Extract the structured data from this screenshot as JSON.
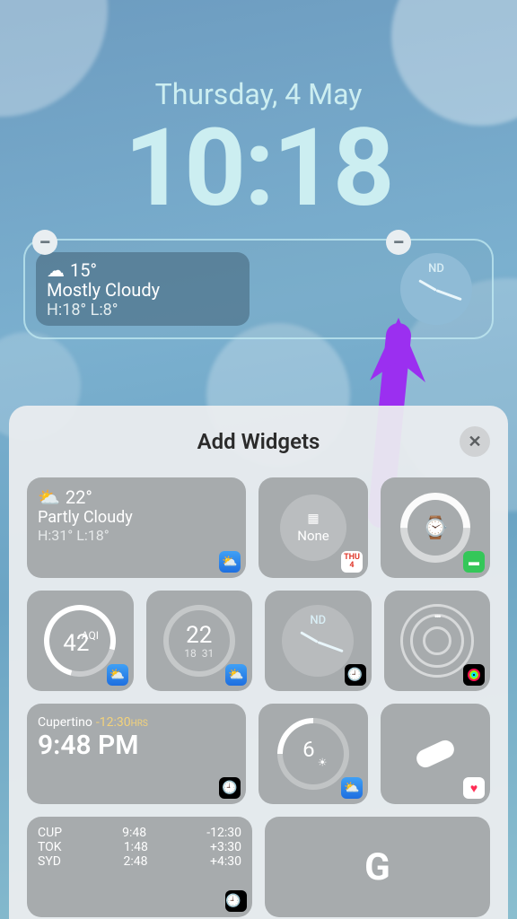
{
  "lockscreen": {
    "date": "Thursday, 4 May",
    "time": "10:18",
    "placed_weather": {
      "temp": "15°",
      "condition": "Mostly Cloudy",
      "hilo": "H:18° L:8°"
    },
    "placed_clock": {
      "label": "ND"
    }
  },
  "sheet": {
    "title": "Add Widgets",
    "close": "✕"
  },
  "widgets": {
    "weather_big": {
      "temp": "22°",
      "condition": "Partly Cloudy",
      "hilo": "H:31° L:18°"
    },
    "calendar": {
      "label": "None",
      "badge_day": "4",
      "badge_dow": "THU"
    },
    "battery": {},
    "aqi": {
      "value": "42",
      "label": "AQI"
    },
    "temp_range": {
      "value": "22",
      "low": "18",
      "high": "31"
    },
    "city_clock": {
      "label": "ND"
    },
    "fitness": {},
    "world_single": {
      "city": "Cupertino",
      "offset": "-12:30",
      "unit": "HRS",
      "time": "9:48 PM"
    },
    "uv": {
      "value": "6"
    },
    "meds": {},
    "world_list": {
      "rows": [
        {
          "city": "CUP",
          "time": "9:48",
          "off": "-12:30"
        },
        {
          "city": "TOK",
          "time": "1:48",
          "off": "+3:30"
        },
        {
          "city": "SYD",
          "time": "2:48",
          "off": "+4:30"
        }
      ]
    },
    "google": {
      "label": "G"
    }
  },
  "remove_label": "−"
}
